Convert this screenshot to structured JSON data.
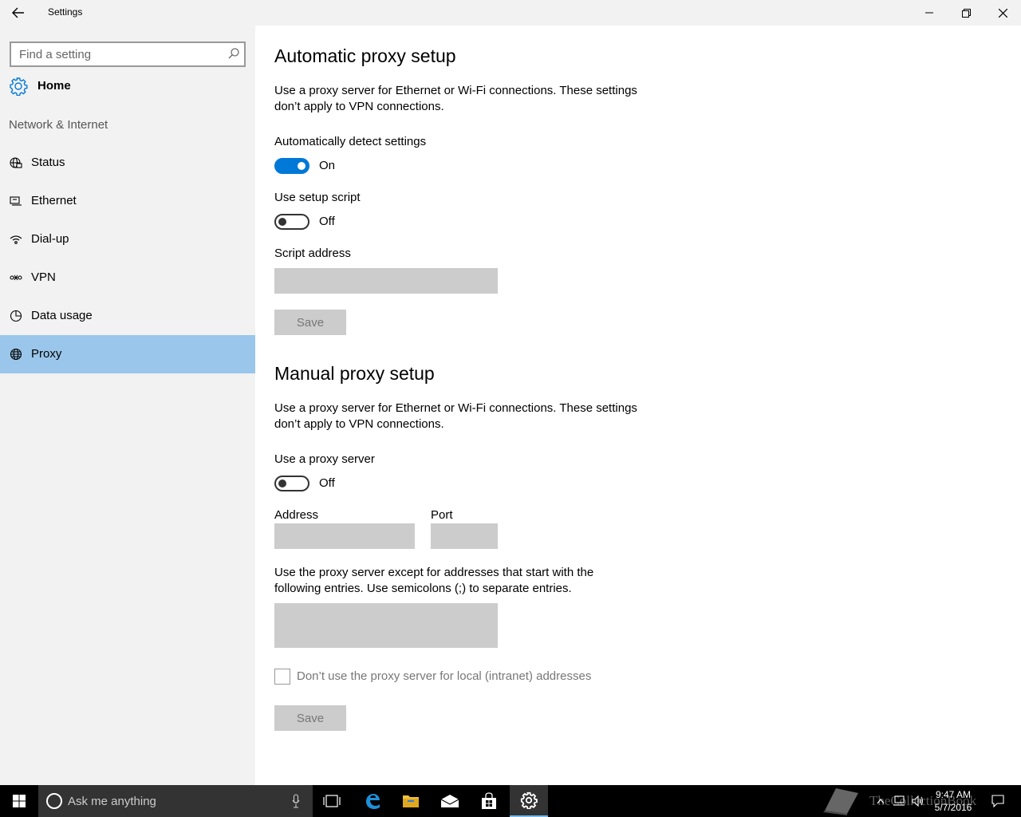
{
  "window": {
    "title": "Settings"
  },
  "sidebar": {
    "search_placeholder": "Find a setting",
    "home_label": "Home",
    "section_label": "Network & Internet",
    "items": [
      {
        "label": "Status",
        "icon": "globe-status-icon"
      },
      {
        "label": "Ethernet",
        "icon": "ethernet-icon"
      },
      {
        "label": "Dial-up",
        "icon": "dialup-icon"
      },
      {
        "label": "VPN",
        "icon": "vpn-icon"
      },
      {
        "label": "Data usage",
        "icon": "data-usage-icon"
      },
      {
        "label": "Proxy",
        "icon": "globe-icon",
        "selected": true
      }
    ]
  },
  "automatic": {
    "heading": "Automatic proxy setup",
    "description": "Use a proxy server for Ethernet or Wi-Fi connections. These settings don’t apply to VPN connections.",
    "detect_label": "Automatically detect settings",
    "detect_state": "On",
    "script_label": "Use setup script",
    "script_state": "Off",
    "address_label": "Script address",
    "address_value": "",
    "save_label": "Save"
  },
  "manual": {
    "heading": "Manual proxy setup",
    "description": "Use a proxy server for Ethernet or Wi-Fi connections. These settings don’t apply to VPN connections.",
    "use_proxy_label": "Use a proxy server",
    "use_proxy_state": "Off",
    "address_label": "Address",
    "address_value": "",
    "port_label": "Port",
    "port_value": "",
    "exceptions_text": "Use the proxy server except for addresses that start with the following entries. Use semicolons (;) to separate entries.",
    "exceptions_value": "",
    "local_checkbox_label": "Don’t use the proxy server for local (intranet) addresses",
    "local_checked": false,
    "save_label": "Save"
  },
  "taskbar": {
    "search_placeholder": "Ask me anything",
    "time": "9:47 AM",
    "date": "5/7/2016",
    "watermark": "TheCollectionBook"
  },
  "colors": {
    "accent": "#0078d7",
    "selected_nav": "#99c6ea",
    "sidebar_bg": "#f2f2f2",
    "disabled_field": "#cccccc"
  }
}
